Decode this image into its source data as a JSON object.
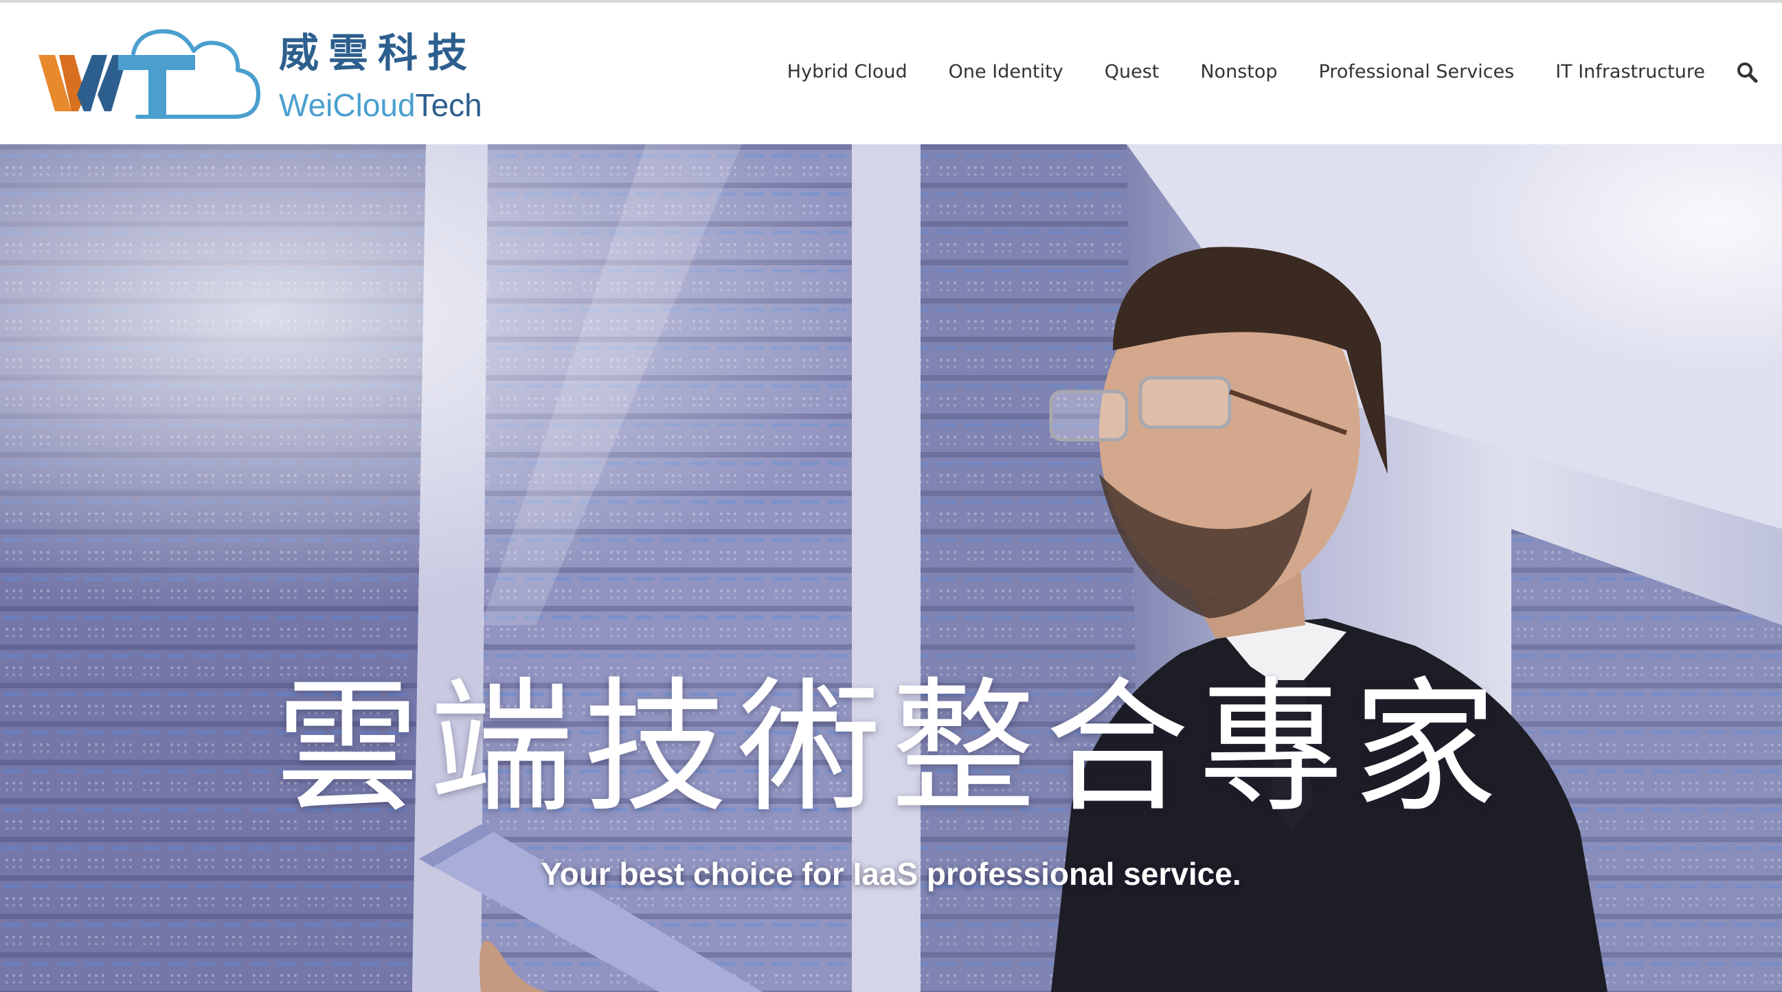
{
  "header": {
    "logo": {
      "mark_text": "WT",
      "chinese_name": "威雲科技",
      "english_name_part1": "WeiCloud",
      "english_name_part2": "Tech"
    },
    "nav": [
      {
        "label": "Hybrid Cloud"
      },
      {
        "label": "One Identity"
      },
      {
        "label": "Quest"
      },
      {
        "label": "Nonstop"
      },
      {
        "label": "Professional Services"
      },
      {
        "label": "IT Infrastructure"
      }
    ],
    "search_icon": "search-icon"
  },
  "hero": {
    "title": "雲端技術整合專家",
    "subtitle": "Your best choice for IaaS professional service.",
    "image": "man-in-suit-holding-tablet-in-server-room"
  },
  "colors": {
    "brand_dark_blue": "#2d5f8e",
    "brand_light_blue": "#4a9fcf",
    "brand_orange": "#e8892e",
    "nav_text": "#333333"
  }
}
